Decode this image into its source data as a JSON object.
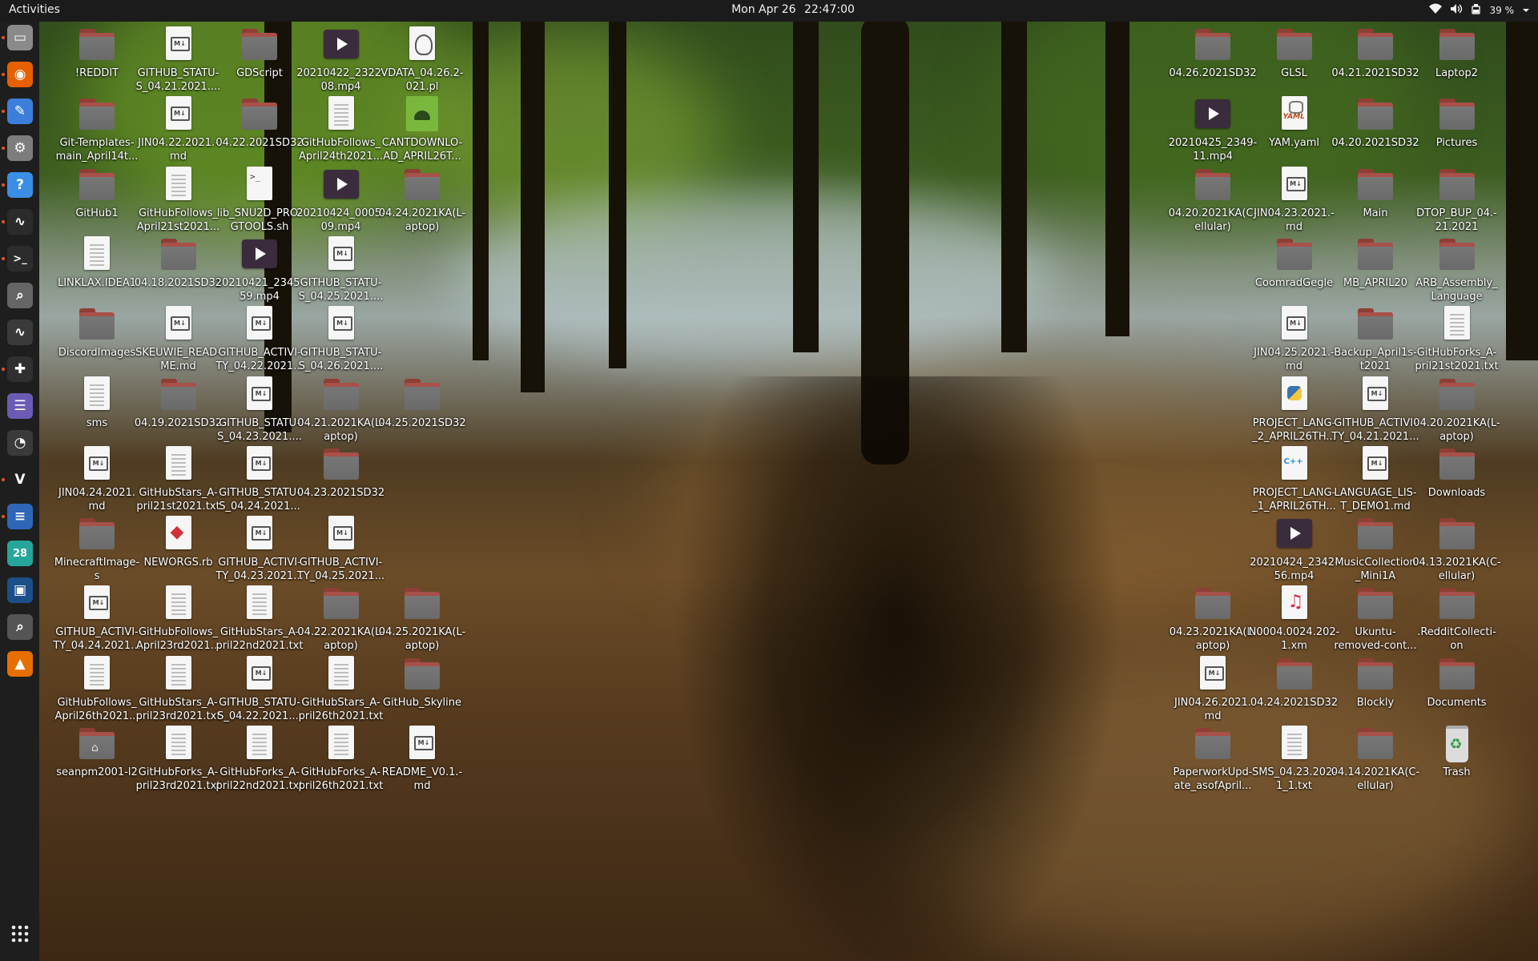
{
  "topbar": {
    "activities": "Activities",
    "date": "Mon Apr 26",
    "time": "22:47:00",
    "battery": "39 %"
  },
  "dock": [
    {
      "name": "files-icon",
      "color": "#8a8a8a",
      "glyph": "▭",
      "active": true
    },
    {
      "name": "firefox-icon",
      "color": "#e66000",
      "glyph": "◉",
      "active": true
    },
    {
      "name": "text-editor-icon",
      "color": "#3d7edb",
      "glyph": "✎",
      "active": true
    },
    {
      "name": "settings-icon",
      "color": "#7d7d7d",
      "glyph": "⚙",
      "active": true
    },
    {
      "name": "help-icon",
      "color": "#3a8ee6",
      "glyph": "?",
      "active": true
    },
    {
      "name": "system-monitor-icon",
      "color": "#2b2b2b",
      "glyph": "∿",
      "active": true
    },
    {
      "name": "terminal-icon",
      "color": "#2c2c2c",
      "glyph": ">_",
      "active": true
    },
    {
      "name": "search-icon",
      "color": "#666",
      "glyph": "⌕",
      "active": false
    },
    {
      "name": "audio-analyzer-icon",
      "color": "#3a3a3a",
      "glyph": "∿",
      "active": false
    },
    {
      "name": "puzzle-icon",
      "color": "#2f2f2f",
      "glyph": "✚",
      "active": true
    },
    {
      "name": "tweaks-icon",
      "color": "#6b5bb5",
      "glyph": "☰",
      "active": false
    },
    {
      "name": "clock-icon",
      "color": "#3a3a3a",
      "glyph": "◔",
      "active": false
    },
    {
      "name": "vim-icon",
      "color": "#1f1f1f",
      "glyph": "V",
      "active": true
    },
    {
      "name": "document-viewer-icon",
      "color": "#2e67b8",
      "glyph": "≡",
      "active": true
    },
    {
      "name": "calendar-icon",
      "color": "#26a69a",
      "glyph": "28",
      "active": false
    },
    {
      "name": "virtualbox-icon",
      "color": "#1b4f8a",
      "glyph": "▣",
      "active": false
    },
    {
      "name": "magnifier-icon",
      "color": "#555",
      "glyph": "⌕",
      "active": false
    },
    {
      "name": "vlc-icon",
      "color": "#e57000",
      "glyph": "▲",
      "active": false
    }
  ],
  "show_apps_label": "Show Applications",
  "icons_left": [
    [
      {
        "type": "folder",
        "label": "!REDDIT"
      },
      {
        "type": "folder",
        "label": "Git-Templates-\nmain_April14t..."
      },
      {
        "type": "folder",
        "label": "GitHub1"
      },
      {
        "type": "text",
        "label": "LINKLAX.IDEA1"
      },
      {
        "type": "folder",
        "label": "DiscordImages"
      },
      {
        "type": "text",
        "label": "sms"
      },
      {
        "type": "md",
        "label": "JIN04.24.2021.\nmd"
      },
      {
        "type": "folder",
        "label": "MinecraftImage-\ns"
      },
      {
        "type": "md",
        "label": "GITHUB_ACTIVI-\nTY_04.24.2021..."
      },
      {
        "type": "text",
        "label": "GitHubFollows_\nApril26th2021..."
      },
      {
        "type": "home",
        "label": "seanpm2001-l2"
      }
    ],
    [
      {
        "type": "md",
        "label": "GITHUB_STATU-\nS_04.21.2021...."
      },
      {
        "type": "md",
        "label": "JIN04.22.2021.-\nmd"
      },
      {
        "type": "text",
        "label": "GitHubFollows_\nApril21st2021..."
      },
      {
        "type": "folder",
        "label": "04.18.2021SD32"
      },
      {
        "type": "md",
        "label": "SKEUWIE_READ-\nME.md"
      },
      {
        "type": "folder",
        "label": "04.19.2021SD32"
      },
      {
        "type": "text",
        "label": "GitHubStars_A-\npril21st2021.txt"
      },
      {
        "type": "rb",
        "label": "NEWORGS.rb"
      },
      {
        "type": "text",
        "label": "GitHubFollows_\nApril23rd2021..."
      },
      {
        "type": "text",
        "label": "GitHubStars_A-\npril23rd2021.txt"
      },
      {
        "type": "text",
        "label": "GitHubForks_A-\npril23rd2021.txt"
      }
    ],
    [
      {
        "type": "folder",
        "label": "GDScript"
      },
      {
        "type": "folder",
        "label": "04.22.2021SD32"
      },
      {
        "type": "sh",
        "label": "lib_SNU2D_PRO-\nGTOOLS.sh"
      },
      {
        "type": "video",
        "label": "20210421_2345-\n59.mp4"
      },
      {
        "type": "md",
        "label": "GITHUB_ACTIVI-\nTY_04.22.2021..."
      },
      {
        "type": "md",
        "label": "GITHUB_STATU-\nS_04.23.2021...."
      },
      {
        "type": "md",
        "label": "GITHUB_STATU-\nS_04.24.2021..."
      },
      {
        "type": "md",
        "label": "GITHUB_ACTIVI-\nTY_04.23.2021..."
      },
      {
        "type": "text",
        "label": "GitHubStars_A-\npril22nd2021.txt"
      },
      {
        "type": "md",
        "label": "GITHUB_STATU-\nS_04.22.2021...."
      },
      {
        "type": "text",
        "label": "GitHubForks_A-\npril22nd2021.txt"
      }
    ],
    [
      {
        "type": "video",
        "label": "20210422_2322-\n08.mp4"
      },
      {
        "type": "text",
        "label": "GitHubFollows_\nApril24th2021..."
      },
      {
        "type": "video",
        "label": "20210424_0005-\n09.mp4"
      },
      {
        "type": "md",
        "label": "GITHUB_STATU-\nS_04.25.2021...."
      },
      {
        "type": "md",
        "label": "GITHUB_STATU-\nS_04.26.2021...."
      },
      {
        "type": "folder",
        "label": "04.21.2021KA(L-\naptop)"
      },
      {
        "type": "folder",
        "label": "04.23.2021SD32"
      },
      {
        "type": "md",
        "label": "GITHUB_ACTIVI-\nTY_04.25.2021..."
      },
      {
        "type": "folder",
        "label": "04.22.2021KA(L-\naptop)"
      },
      {
        "type": "text",
        "label": "GitHubStars_A-\npril26th2021.txt"
      },
      {
        "type": "text",
        "label": "GitHubForks_A-\npril26th2021.txt"
      }
    ],
    [
      {
        "type": "pl",
        "label": "VDATA_04.26.2-\n021.pl"
      },
      {
        "type": "android",
        "label": "CANTDOWNLO-\nAD_APRIL26T..."
      },
      {
        "type": "folder",
        "label": "04.24.2021KA(L-\naptop)"
      },
      null,
      null,
      {
        "type": "folder",
        "label": "04.25.2021SD32"
      },
      null,
      null,
      {
        "type": "folder",
        "label": "04.25.2021KA(L-\naptop)"
      },
      {
        "type": "folder",
        "label": "GitHub_Skyline"
      },
      {
        "type": "md",
        "label": "README_V0.1.-\nmd"
      }
    ]
  ],
  "icons_right": [
    [
      {
        "type": "folder",
        "label": "04.26.2021SD32"
      },
      {
        "type": "video",
        "label": "20210425_2349-\n11.mp4"
      },
      {
        "type": "folder",
        "label": "04.20.2021KA(C-\nellular)"
      },
      null,
      null,
      null,
      null,
      null,
      {
        "type": "folder",
        "label": "04.23.2021KA(L-\naptop)"
      },
      {
        "type": "md",
        "label": "JIN04.26.2021.\nmd"
      },
      {
        "type": "folder",
        "label": "PaperworkUpd-\nate_asofApril..."
      }
    ],
    [
      {
        "type": "folder",
        "label": "GLSL"
      },
      {
        "type": "yaml",
        "label": "YAM.yaml"
      },
      {
        "type": "md",
        "label": "JIN04.23.2021.-\nmd"
      },
      {
        "type": "folder",
        "label": "CoomradGegle"
      },
      {
        "type": "md",
        "label": "JIN04.25.2021.-\nmd"
      },
      {
        "type": "py",
        "label": "PROJECT_LANG-\n_2_APRIL26TH..."
      },
      {
        "type": "cpp",
        "label": "PROJECT_LANG-\n_1_APRIL26TH..."
      },
      {
        "type": "video",
        "label": "20210424_2342-\n56.mp4"
      },
      {
        "type": "xm",
        "label": "N0004.0024.202-\n1.xm"
      },
      {
        "type": "folder",
        "label": "04.24.2021SD32"
      },
      {
        "type": "text",
        "label": "SMS_04.23.202-\n1_1.txt"
      }
    ],
    [
      {
        "type": "folder",
        "label": "04.21.2021SD32"
      },
      {
        "type": "folder",
        "label": "04.20.2021SD32"
      },
      {
        "type": "folder",
        "label": "Main"
      },
      {
        "type": "folder",
        "label": "MB_APRIL20"
      },
      {
        "type": "folder",
        "label": "Backup_April1s-\nt2021"
      },
      {
        "type": "md",
        "label": "GITHUB_ACTIVI-\nTY_04.21.2021..."
      },
      {
        "type": "md",
        "label": "LANGUAGE_LIS-\nT_DEMO1.md"
      },
      {
        "type": "folder",
        "label": "MusicCollection\n_Mini1A"
      },
      {
        "type": "folder",
        "label": "Ukuntu-\nremoved-cont..."
      },
      {
        "type": "folder",
        "label": "Blockly"
      },
      {
        "type": "folder",
        "label": "04.14.2021KA(C-\nellular)"
      }
    ],
    [
      {
        "type": "folder",
        "label": "Laptop2"
      },
      {
        "type": "folder",
        "label": "Pictures"
      },
      {
        "type": "folder",
        "label": "DTOP_BUP_04.-\n21.2021"
      },
      {
        "type": "folder",
        "label": "ARB_Assembly_\nLanguage"
      },
      {
        "type": "text",
        "label": "GitHubForks_A-\npril21st2021.txt"
      },
      {
        "type": "folder",
        "label": "04.20.2021KA(L-\naptop)"
      },
      {
        "type": "folder",
        "label": "Downloads"
      },
      {
        "type": "folder",
        "label": "04.13.2021KA(C-\nellular)"
      },
      {
        "type": "folder",
        "label": ".RedditCollecti-\non"
      },
      {
        "type": "folder",
        "label": "Documents"
      },
      {
        "type": "trash",
        "label": "Trash"
      }
    ]
  ]
}
